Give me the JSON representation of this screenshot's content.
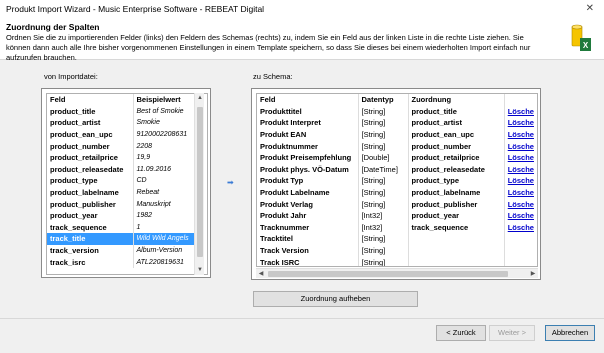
{
  "window": {
    "title": "Produkt Import Wizard - Music Enterprise Software - REBEAT Digital",
    "close": "✕"
  },
  "header": {
    "title": "Zuordnung der Spalten",
    "description": "Ordnen Sie die zu importierenden Felder (links) den Feldern des Schemas (rechts) zu, indem Sie ein Feld aus der linken Liste in die rechte Liste ziehen. Sie können dann auch alle Ihre bisher vorgenommenen Einstellungen in einem Template speichern, so dass Sie dieses bei einem wiederholten Import einfach nur aufzurufen brauchen."
  },
  "left": {
    "label": "von Importdatei:",
    "columns": [
      "Feld",
      "Beispielwert"
    ],
    "selected_index": 11,
    "rows": [
      [
        "product_title",
        "Best of Smokie"
      ],
      [
        "product_artist",
        "Smokie"
      ],
      [
        "product_ean_upc",
        "9120002208631"
      ],
      [
        "product_number",
        "2208"
      ],
      [
        "product_retailprice",
        "19,9"
      ],
      [
        "product_releasedate",
        "11.09.2016"
      ],
      [
        "product_type",
        "CD"
      ],
      [
        "product_labelname",
        "Rebeat"
      ],
      [
        "product_publisher",
        "Manuskript"
      ],
      [
        "product_year",
        "1982"
      ],
      [
        "track_sequence",
        "1"
      ],
      [
        "track_title",
        "Wild Wild Angels"
      ],
      [
        "track_version",
        "Album-Version"
      ],
      [
        "track_isrc",
        "ATL220819631"
      ]
    ]
  },
  "right": {
    "label": "zu Schema:",
    "columns": [
      "Feld",
      "Datentyp",
      "Zuordnung",
      ""
    ],
    "rows": [
      [
        "Produkttitel",
        "[String]",
        "product_title",
        "Lösche"
      ],
      [
        "Produkt Interpret",
        "[String]",
        "product_artist",
        "Lösche"
      ],
      [
        "Produkt EAN",
        "[String]",
        "product_ean_upc",
        "Lösche"
      ],
      [
        "Produktnummer",
        "[String]",
        "product_number",
        "Lösche"
      ],
      [
        "Produkt Preisempfehlung",
        "[Double]",
        "product_retailprice",
        "Lösche"
      ],
      [
        "Produkt phys. VÖ-Datum",
        "[DateTime]",
        "product_releasedate",
        "Lösche"
      ],
      [
        "Produkt Typ",
        "[String]",
        "product_type",
        "Lösche"
      ],
      [
        "Produkt Labelname",
        "[String]",
        "product_labelname",
        "Lösche"
      ],
      [
        "Produkt Verlag",
        "[String]",
        "product_publisher",
        "Lösche"
      ],
      [
        "Produkt Jahr",
        "[Int32]",
        "product_year",
        "Lösche"
      ],
      [
        "Tracknummer",
        "[Int32]",
        "track_sequence",
        "Lösche"
      ],
      [
        "Tracktitel",
        "[String]",
        "",
        ""
      ],
      [
        "Track Version",
        "[String]",
        "",
        ""
      ],
      [
        "Track ISRC",
        "[String]",
        "",
        ""
      ]
    ]
  },
  "buttons": {
    "unassign": "Zuordnung aufheben",
    "back": "< Zurück",
    "next": "Weiter >",
    "cancel": "Abbrechen"
  },
  "icons": {
    "arrow": "➡"
  }
}
